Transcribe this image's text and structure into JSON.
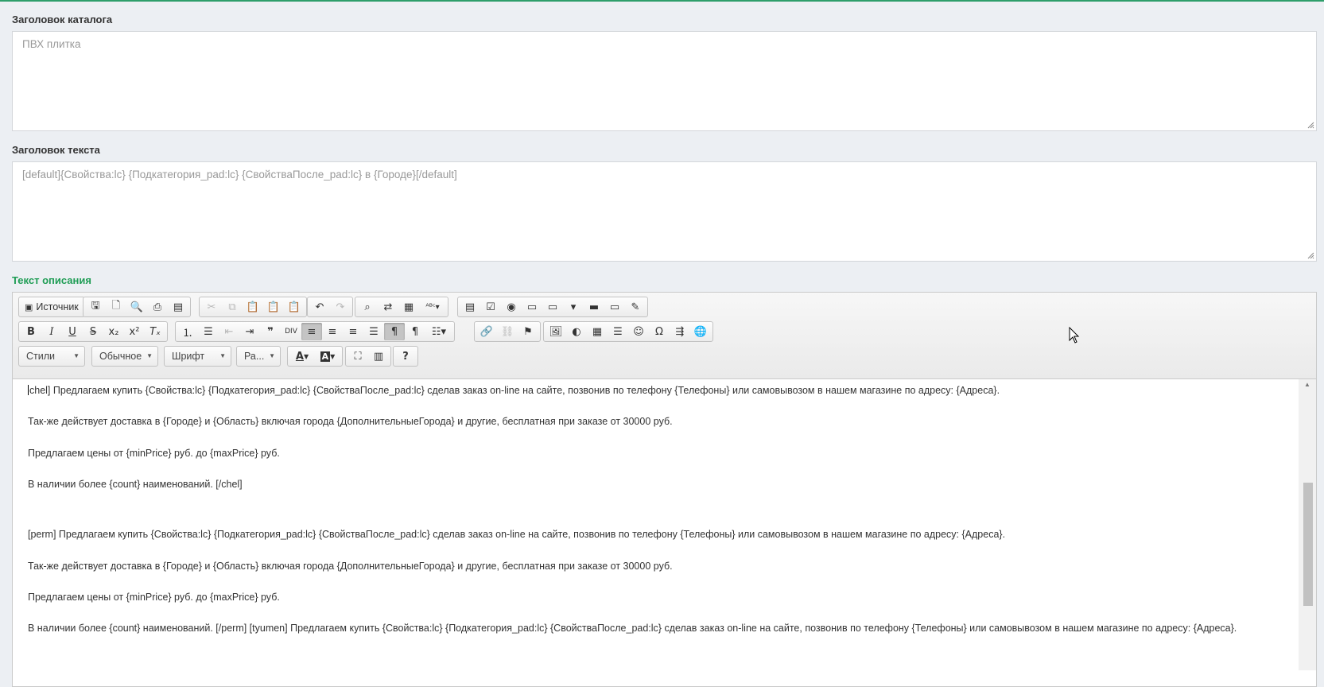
{
  "catalog_title": {
    "label": "Заголовок каталога",
    "placeholder": "ПВХ плитка"
  },
  "text_title": {
    "label": "Заголовок текста",
    "placeholder": "[default]{Свойства:lc} {Подкатегория_pad:lc} {СвойстваПосле_pad:lc} в {Городе}[/default]"
  },
  "description": {
    "label": "Текст описания",
    "label_color": "#1f9d55"
  },
  "toolbar": {
    "source_label": "Источник",
    "styles_label": "Стили",
    "format_label": "Обычное",
    "font_label": "Шрифт",
    "size_label": "Ра...",
    "help_label": "?",
    "icons_row1_group1": [
      "save-icon",
      "new-page-icon",
      "preview-icon",
      "print-icon",
      "templates-icon"
    ],
    "icons_row1_group2": [
      "cut-icon",
      "copy-icon",
      "paste-icon",
      "paste-text-icon",
      "paste-word-icon"
    ],
    "icons_row1_group3": [
      "undo-icon",
      "redo-icon"
    ],
    "icons_row1_group4": [
      "find-icon",
      "replace-icon",
      "select-all-icon",
      "spellcheck-icon"
    ],
    "icons_row1_group5": [
      "form-icon",
      "checkbox-icon",
      "radio-icon",
      "textfield-icon",
      "textarea-icon",
      "select-icon",
      "button-icon",
      "image-button-icon",
      "hidden-field-icon"
    ],
    "icons_row2_group1": [
      "bold-icon",
      "italic-icon",
      "underline-icon",
      "strike-icon",
      "subscript-icon",
      "superscript-icon",
      "remove-format-icon"
    ],
    "icons_row2_group2": [
      "numbered-list-icon",
      "bulleted-list-icon",
      "outdent-icon",
      "indent-icon",
      "blockquote-icon",
      "div-icon",
      "align-left-icon",
      "align-center-icon",
      "align-right-icon",
      "justify-icon",
      "ltr-icon",
      "rtl-icon",
      "language-icon"
    ],
    "icons_row2_group3": [
      "link-icon",
      "unlink-icon",
      "anchor-icon"
    ],
    "icons_row2_group4": [
      "image-icon",
      "flash-icon",
      "table-icon",
      "horizontal-rule-icon",
      "smiley-icon",
      "special-char-icon",
      "page-break-icon",
      "iframe-icon"
    ]
  },
  "editor_lines": [
    "chel] Предлагаем купить {Свойства:lc} {Подкатегория_pad:lc} {СвойстваПосле_pad:lc} сделав заказ on-line на сайте, позвонив по телефону {Телефоны} или самовывозом в нашем магазине по адресу: {Адреса}.",
    "Так-же действует доставка в {Городе} и {Область} включая города {ДополнительныеГорода} и другие, бесплатная при заказе от 30000 руб.",
    "Предлагаем цены от {minPrice} руб. до {maxPrice} руб.",
    "В наличии более {count} наименований. [/chel]",
    "[perm] Предлагаем купить {Свойства:lc} {Подкатегория_pad:lc} {СвойстваПосле_pad:lc} сделав заказ on-line на сайте, позвонив по телефону {Телефоны} или самовывозом в нашем магазине по адресу: {Адреса}.",
    "Так-же действует доставка в {Городе} и {Область} включая города {ДополнительныеГорода} и другие, бесплатная при заказе от 30000 руб.",
    "Предлагаем цены от {minPrice} руб. до {maxPrice} руб.",
    "В наличии более {count} наименований. [/perm] [tyumen] Предлагаем купить {Свойства:lc} {Подкатегория_pad:lc} {СвойстваПосле_pad:lc} сделав заказ on-line на сайте, позвонив по телефону {Телефоны} или самовывозом в нашем магазине по адресу: {Адреса}."
  ],
  "colors": {
    "accent": "#1f9d55",
    "top_line": "#2e9e6a",
    "page_bg": "#eceff3"
  }
}
